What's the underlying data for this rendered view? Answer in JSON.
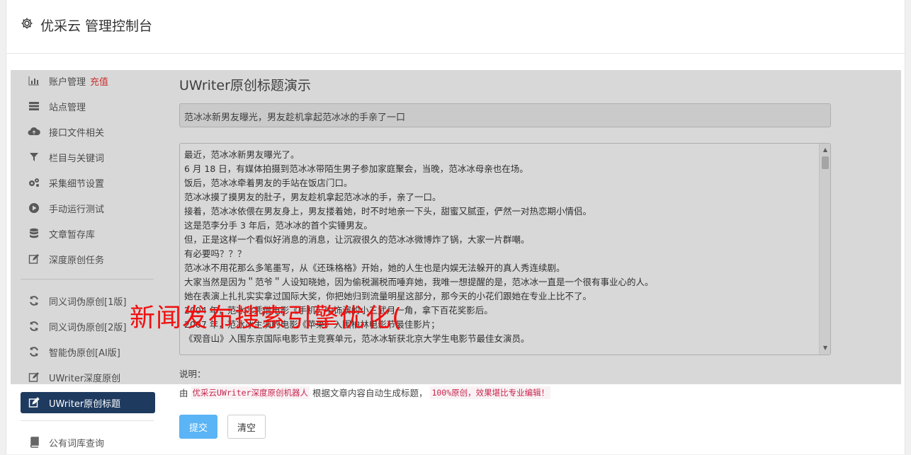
{
  "header": {
    "title": "优采云 管理控制台"
  },
  "sidebar": {
    "items": [
      {
        "label": "账户管理",
        "badge": "充值"
      },
      {
        "label": "站点管理"
      },
      {
        "label": "接口文件相关"
      },
      {
        "label": "栏目与关键词"
      },
      {
        "label": "采集细节设置"
      },
      {
        "label": "手动运行测试"
      },
      {
        "label": "文章暂存库"
      },
      {
        "label": "深度原创任务"
      },
      {
        "label": "同义词伪原创[1版]"
      },
      {
        "label": "同义词伪原创[2版]"
      },
      {
        "label": "智能伪原创[AI版]"
      },
      {
        "label": "UWriter深度原创"
      },
      {
        "label": "UWriter原创标题"
      },
      {
        "label": "公有词库查询"
      }
    ]
  },
  "main": {
    "title": "UWriter原创标题演示",
    "title_value": "范冰冰新男友曝光，男友趁机拿起范冰冰的手亲了一口",
    "content_lines": [
      "最近，范冰冰新男友曝光了。",
      "6 月 18 日，有媒体拍摄到范冰冰带陌生男子参加家庭聚会，当晚，范冰冰母亲也在场。",
      "饭后，范冰冰牵着男友的手站在饭店门口。",
      "范冰冰摸了摸男友的肚子，男友趁机拿起范冰冰的手，亲了一口。",
      "接着，范冰冰依偎在男友身上，男友搂着她，时不时地亲一下头，甜蜜又腻歪，俨然一对热恋期小情侣。",
      "这是范李分手 3 年后，范冰冰的首个实锤男友。",
      "但，正是这样一个看似好消息的消息，让沉寂很久的范冰冰微博炸了锅，大家一片群嘲。",
      "有必要吗？？？",
      "范冰冰不用花那么多笔墨写，从《还珠格格》开始，她的人生也是内娱无法躲开的真人秀连续剧。",
      "大家当然是因为＂范爷＂人设知晓她，因为偷税漏税而唾弃她，我唯一想提醒的是，范冰冰一直是一个很有事业心的人。",
      "她在表演上扎扎实实拿过国际大奖，你把她归到流量明星这部分，那今天的小花们跟她在专业上比不了。",
      "2004 年，范冰冰凭借电影《手机》中饰演的小三武月一角，拿下百花奖影后。",
      "2007 年，范冰冰主演的电影《苹果》入围柏林电影节最佳影片；",
      "《观音山》入围东京国际电影节主竞赛单元，范冰冰斩获北京大学生电影节最佳女演员。"
    ],
    "note_label": "说明：",
    "note_prefix": "由",
    "note_highlight1": "优采云UWriter深度原创机器人",
    "note_middle": "根据文章内容自动生成标题，",
    "note_highlight2": "100%原创，效果堪比专业编辑！",
    "submit_label": "提交",
    "clear_label": "清空"
  },
  "watermark": "新闻发布搜索引擎优化(",
  "colors": {
    "active_nav": "#1e3a5f",
    "primary_button": "#5bb4f5",
    "badge": "#e33333",
    "watermark": "#f01010"
  }
}
